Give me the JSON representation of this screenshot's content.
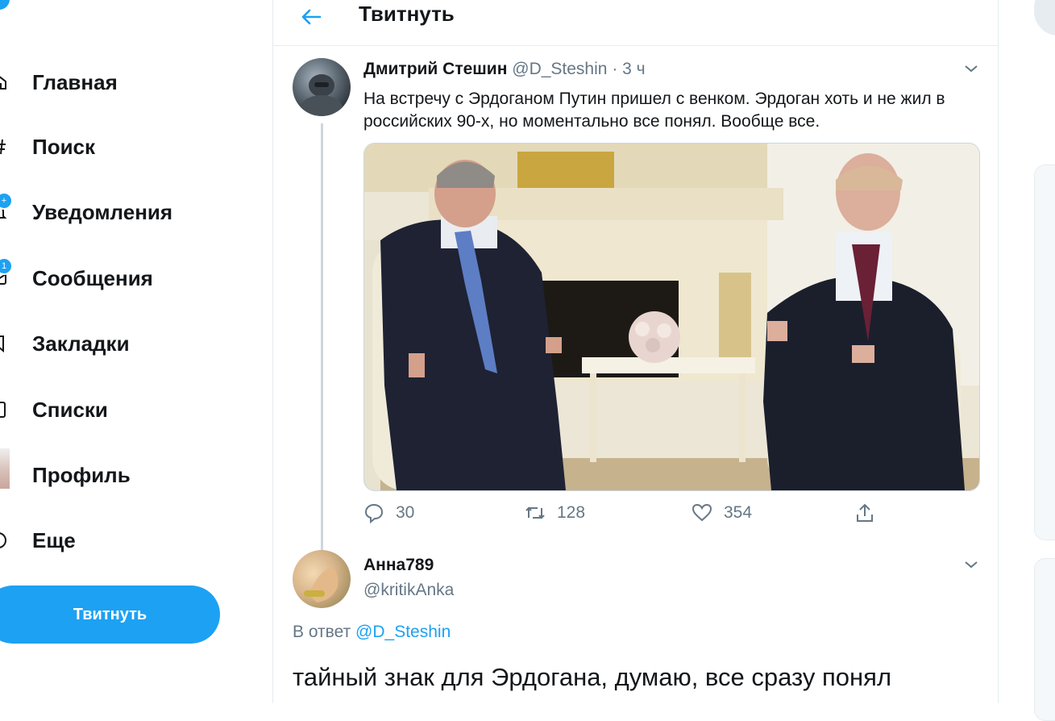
{
  "sidebar": {
    "items": [
      {
        "label": "Главная",
        "icon": "home-icon"
      },
      {
        "label": "Поиск",
        "icon": "hashtag-icon"
      },
      {
        "label": "Уведомления",
        "icon": "bell-icon",
        "badge": "+"
      },
      {
        "label": "Сообщения",
        "icon": "mail-icon",
        "badge": "1"
      },
      {
        "label": "Закладки",
        "icon": "bookmark-icon"
      },
      {
        "label": "Списки",
        "icon": "list-icon"
      },
      {
        "label": "Профиль",
        "icon": "profile-avatar"
      },
      {
        "label": "Еще",
        "icon": "more-circle-icon"
      }
    ],
    "tweet_button": "Твитнуть"
  },
  "header": {
    "title": "Твитнуть"
  },
  "tweet": {
    "author_name": "Дмитрий Стешин",
    "handle": "@D_Steshin",
    "separator": "·",
    "time": "3 ч",
    "text": "На встречу с Эрдоганом Путин пришел с венком. Эрдоган хоть и не жил в российских 90-х, но моментально все понял. Вообще все.",
    "stats": {
      "replies": "30",
      "retweets": "128",
      "likes": "354"
    }
  },
  "reply": {
    "author_name": "Анна789",
    "handle": "@kritikAnka",
    "in_reply_prefix": "В ответ",
    "in_reply_to": "@D_Steshin",
    "text": "тайный знак для Эрдогана, думаю, все сразу понял"
  },
  "colors": {
    "accent": "#1da1f2",
    "secondary_text": "#657786",
    "border": "#e6ecf0"
  }
}
